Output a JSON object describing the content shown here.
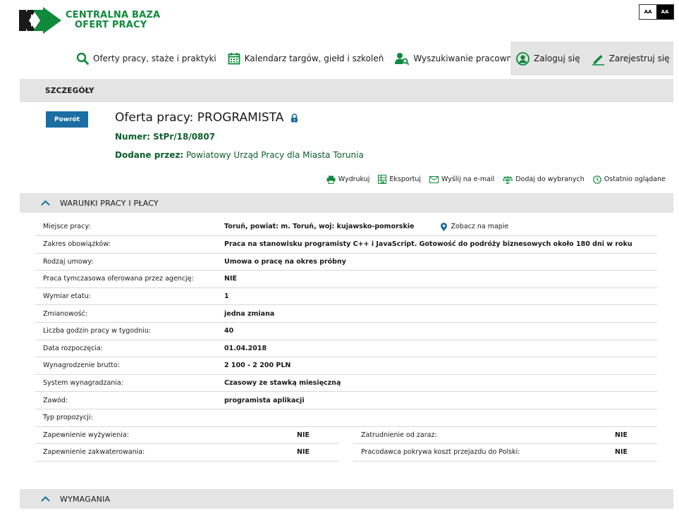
{
  "logo": {
    "line1": "CENTRALNA BAZA",
    "line2": "OFERT PRACY"
  },
  "contrast": {
    "normal": "AA",
    "high": "AA"
  },
  "nav": {
    "items": [
      {
        "label": "Oferty pracy, staże i praktyki",
        "icon": "search-icon"
      },
      {
        "label": "Kalendarz targów, giełd i szkoleń",
        "icon": "calendar-icon"
      },
      {
        "label": "Wyszukiwanie pracowników",
        "icon": "user-search-icon"
      }
    ],
    "login": "Zaloguj się",
    "register": "Zarejestruj się"
  },
  "details_bar": "SZCZEGÓŁY",
  "back_button": "Powrót",
  "offer": {
    "title": "Oferta pracy: PROGRAMISTA",
    "number_label": "Numer:",
    "number": "StPr/18/0807",
    "added_by_label": "Dodane przez:",
    "added_by": "Powiatowy Urząd Pracy dla Miasta Torunia"
  },
  "actions": {
    "print": "Wydrukuj",
    "export": "Eksportuj",
    "email": "Wyślij na e-mail",
    "favorites": "Dodaj do wybranych",
    "recent": "Ostatnio oglądane"
  },
  "sections": {
    "warunki": "WARUNKI PRACY I PŁACY",
    "wymagania": "WYMAGANIA"
  },
  "conditions": {
    "place_label": "Miejsce pracy:",
    "place_value": "Toruń, powiat: m. Toruń, woj: kujawsko-pomorskie",
    "map_link": "Zobacz na mapie",
    "rows": [
      {
        "label": "Zakres obowiązków:",
        "value": "Praca na stanowisku programisty C++ i JavaScript. Gotowość do podróży biznesowych około 180 dni w roku"
      },
      {
        "label": "Rodzaj umowy:",
        "value": "Umowa o pracę na okres próbny"
      },
      {
        "label": "Praca tymczasowa oferowana przez agencję:",
        "value": "NIE"
      },
      {
        "label": "Wymiar etatu:",
        "value": "1"
      },
      {
        "label": "Zmianowość:",
        "value": "jedna zmiana"
      },
      {
        "label": "Liczba godzin pracy w tygodniu:",
        "value": "40"
      },
      {
        "label": "Data rozpoczęcia:",
        "value": "01.04.2018"
      },
      {
        "label": "Wynagrodzenie brutto:",
        "value": "2 100 - 2 200 PLN"
      },
      {
        "label": "System wynagradzania:",
        "value": "Czasowy ze stawką miesięczną"
      },
      {
        "label": "Zawód:",
        "value": "programista aplikacji"
      },
      {
        "label": "Typ propozycji:",
        "value": ""
      }
    ],
    "split_rows": [
      {
        "left_label": "Zapewnienie wyżywienia:",
        "left_value": "NIE",
        "right_label": "Zatrudnienie od zaraz:",
        "right_value": "NIE"
      },
      {
        "left_label": "Zapewnienie zakwaterowania:",
        "left_value": "NIE",
        "right_label": "Pracodawca pokrywa koszt przejazdu do Polski:",
        "right_value": "NIE"
      }
    ]
  },
  "colors": {
    "green": "#0e8a3a",
    "dark_green": "#0b5f2a",
    "blue": "#1b6ea3",
    "gray_bar": "#e4e4e4"
  }
}
